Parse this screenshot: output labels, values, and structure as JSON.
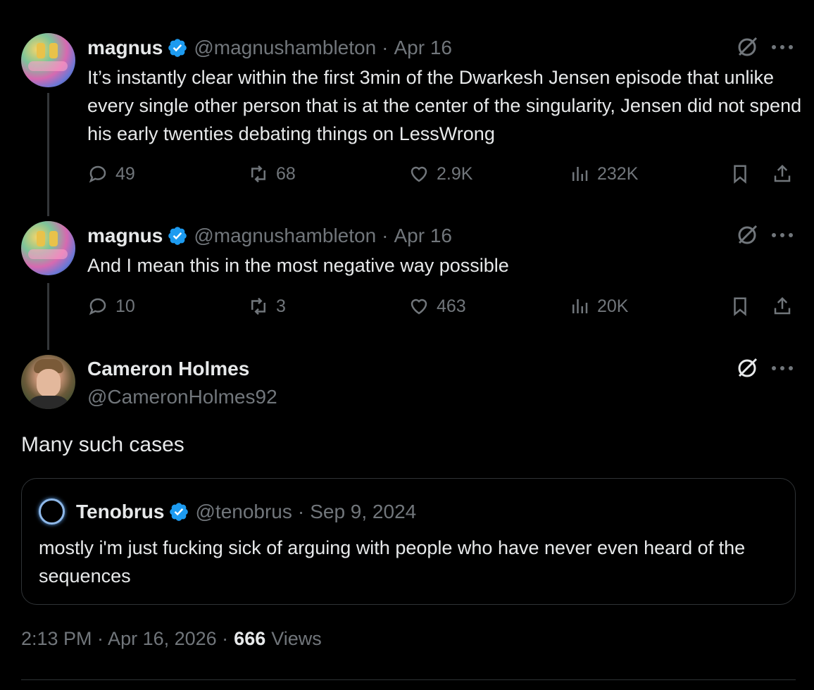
{
  "tweets": [
    {
      "name": "magnus",
      "handle": "@magnushambleton",
      "date": "Apr 16",
      "text": "It’s instantly clear within the first 3min of the Dwarkesh Jensen episode that unlike every single other person that is at the center of the singularity, Jensen did not spend his early twenties debating things on LessWrong",
      "replies": "49",
      "reposts": "68",
      "likes": "2.9K",
      "views": "232K"
    },
    {
      "name": "magnus",
      "handle": "@magnushambleton",
      "date": "Apr 16",
      "text": "And I mean this in the most negative way possible",
      "replies": "10",
      "reposts": "3",
      "likes": "463",
      "views": "20K"
    }
  ],
  "main": {
    "name": "Cameron Holmes",
    "handle": "@CameronHolmes92",
    "text": "Many such cases",
    "timestamp": "2:13 PM · Apr 16, 2026 ·",
    "view_count": "666",
    "views_label": "Views"
  },
  "quote": {
    "name": "Tenobrus",
    "handle": "@tenobrus",
    "date": "Sep 9, 2024",
    "text": "mostly i'm just fucking sick of arguing with people who have never even heard of the sequences"
  },
  "separator": "·",
  "colors": {
    "background": "#000000",
    "text": "#e7e9ea",
    "muted": "#71767b",
    "verified": "#1d9bf0",
    "border": "#2f3336"
  }
}
